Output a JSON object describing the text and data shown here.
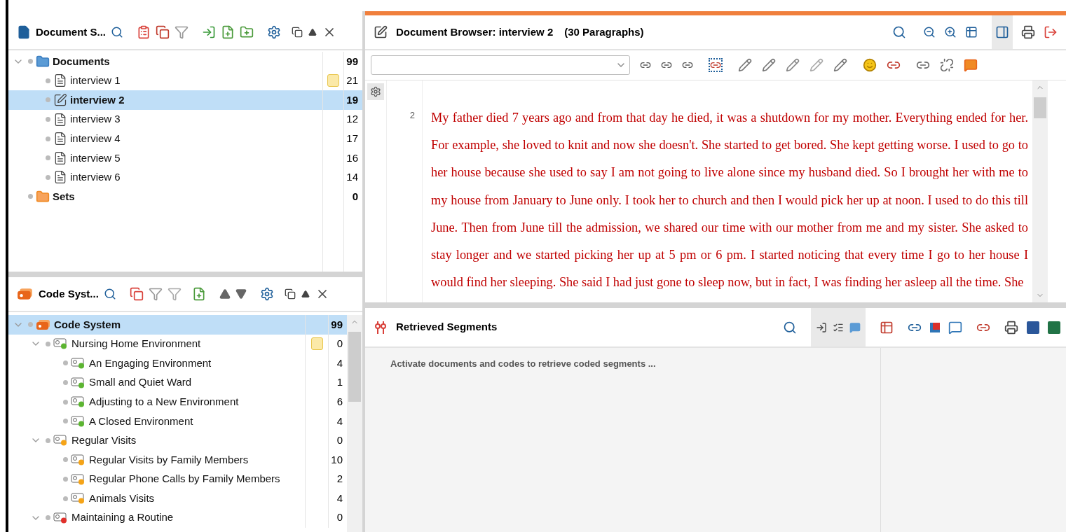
{
  "document_system": {
    "title": "Document S...",
    "items": [
      {
        "label": "Documents",
        "kind": "folder",
        "count": "99",
        "expanded": true,
        "selected": false,
        "memo": false,
        "children": [
          {
            "label": "interview 1",
            "kind": "document",
            "count": "21",
            "memo": true,
            "selected": false
          },
          {
            "label": "interview 2",
            "kind": "open_document",
            "count": "19",
            "memo": false,
            "selected": true
          },
          {
            "label": "interview 3",
            "kind": "document",
            "count": "12",
            "memo": false,
            "selected": false
          },
          {
            "label": "interview 4",
            "kind": "document",
            "count": "17",
            "memo": false,
            "selected": false
          },
          {
            "label": "interview 5",
            "kind": "document",
            "count": "16",
            "memo": false,
            "selected": false
          },
          {
            "label": "interview 6",
            "kind": "document",
            "count": "14",
            "memo": false,
            "selected": false
          }
        ]
      },
      {
        "label": "Sets",
        "kind": "sets",
        "count": "0",
        "memo": false,
        "selected": false
      }
    ]
  },
  "code_system": {
    "title": "Code Syst...",
    "items": [
      {
        "label": "Code System",
        "kind": "root",
        "count": "99",
        "expanded": true,
        "selected": true,
        "memo": false,
        "children": [
          {
            "label": "Nursing Home Environment",
            "kind": "code",
            "color": "#5cb531",
            "count": "0",
            "expanded": true,
            "memo": true,
            "selected": false,
            "children": [
              {
                "label": "An Engaging Environment",
                "kind": "code",
                "color": "#5cb531",
                "count": "4",
                "memo": false,
                "selected": false
              },
              {
                "label": "Small and Quiet Ward",
                "kind": "code",
                "color": "#5cb531",
                "count": "1",
                "memo": false,
                "selected": false
              },
              {
                "label": "Adjusting to a New Environment",
                "kind": "code",
                "color": "#5cb531",
                "count": "6",
                "memo": false,
                "selected": false
              },
              {
                "label": "A Closed Environment",
                "kind": "code",
                "color": "#5cb531",
                "count": "4",
                "memo": false,
                "selected": false
              }
            ]
          },
          {
            "label": "Regular Visits",
            "kind": "code",
            "color": "#f5a418",
            "count": "0",
            "expanded": true,
            "memo": false,
            "selected": false,
            "children": [
              {
                "label": "Regular Visits by Family Members",
                "kind": "code",
                "color": "#f5a418",
                "count": "10",
                "memo": false,
                "selected": false
              },
              {
                "label": "Regular Phone Calls by Family Members",
                "kind": "code",
                "color": "#f5a418",
                "count": "2",
                "memo": false,
                "selected": false
              },
              {
                "label": "Animals Visits",
                "kind": "code",
                "color": "#f5a418",
                "count": "4",
                "memo": false,
                "selected": false
              }
            ]
          },
          {
            "label": "Maintaining a Routine",
            "kind": "code",
            "color": "#e0302b",
            "count": "0",
            "expanded": true,
            "memo": false,
            "selected": false
          }
        ]
      }
    ]
  },
  "document_browser": {
    "title": "Document Browser: interview 2",
    "paragraphs": "(30 Paragraphs)",
    "paragraph_number": "2",
    "text": "My father died 7 years ago and from that day he died, it was a shutdown for my mother. Everything ended for her. For example, she loved to knit and now she doesn't. She started to get bored. She kept getting worse. I used to go to her house because she used to say I am not going to live alone since my husband died. So I brought her with me to my house from January to June only. I took her to church and then I would pick her up at noon. I used to do this till June. Then from June till the admission, we shared our time with our mother from me and my sister. She asked to stay longer and we started picking her up at 5 pm or 6 pm. I started noticing that every time I go to her house I would find her sleeping. She said I had just gone to sleep now, but in fact, I was finding her asleep all the time. She"
  },
  "retrieved_segments": {
    "title": "Retrieved Segments",
    "message": "Activate documents and codes to retrieve coded segments ..."
  }
}
